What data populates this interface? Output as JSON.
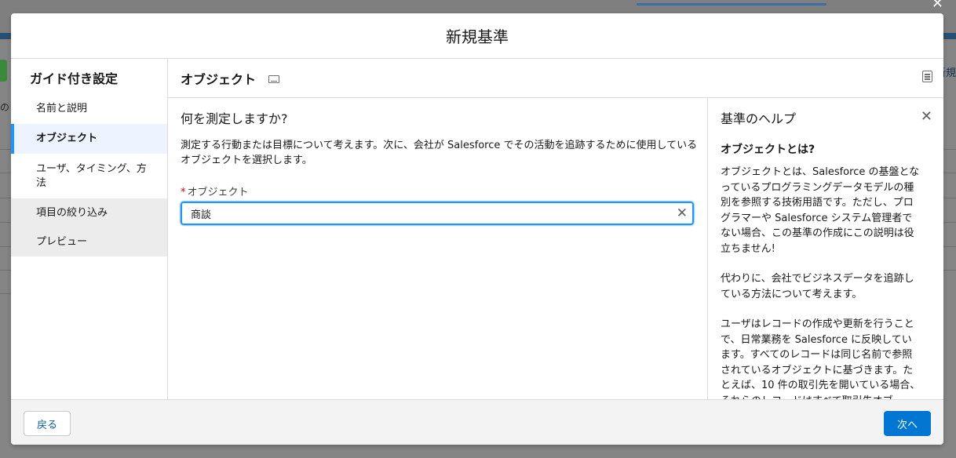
{
  "modal": {
    "title": "新規基準"
  },
  "guide": {
    "title": "ガイド付き設定",
    "items": [
      {
        "label": "名前と説明"
      },
      {
        "label": "オブジェクト"
      },
      {
        "label": "ユーザ、タイミング、方法"
      },
      {
        "label": "項目の絞り込み"
      },
      {
        "label": "プレビュー"
      }
    ]
  },
  "main": {
    "title": "オブジェクト",
    "question": "何を測定しますか?",
    "description": "測定する行動または目標について考えます。次に、会社が Salesforce でその活動を追跡するために使用しているオブジェクトを選択します。",
    "field": {
      "required_mark": "*",
      "label": "オブジェクト",
      "value": "商談"
    }
  },
  "help": {
    "title": "基準のヘルプ",
    "heading": "オブジェクトとは?",
    "paragraphs": [
      "オブジェクトとは、Salesforce の基盤となっているプログラミングデータモデルの種別を参照する技術用語です。ただし、プログラマーや Salesforce システム管理者でない場合、この基準の作成にこの説明は役立ちません!",
      "代わりに、会社でビジネスデータを追跡している方法について考えます。",
      "ユーザはレコードの作成や更新を行うことで、日常業務を Salesforce に反映しています。すべてのレコードは同じ名前で参照されているオブジェクトに基づきます。たとえば、10 件の取引先を開いている場合、それらのレコードはすべて取引先オブ"
    ]
  },
  "footer": {
    "back_label": "戻る",
    "next_label": "次へ"
  },
  "background": {
    "left_text": "の",
    "right_text": "新規"
  },
  "colors": {
    "brand": "#0176d3",
    "focus": "#1b96ff",
    "active_nav_bg": "#eef4ff",
    "required": "#ba0517"
  },
  "icons": [
    "keyboard-icon",
    "notes-icon",
    "close-icon",
    "clear-icon"
  ]
}
